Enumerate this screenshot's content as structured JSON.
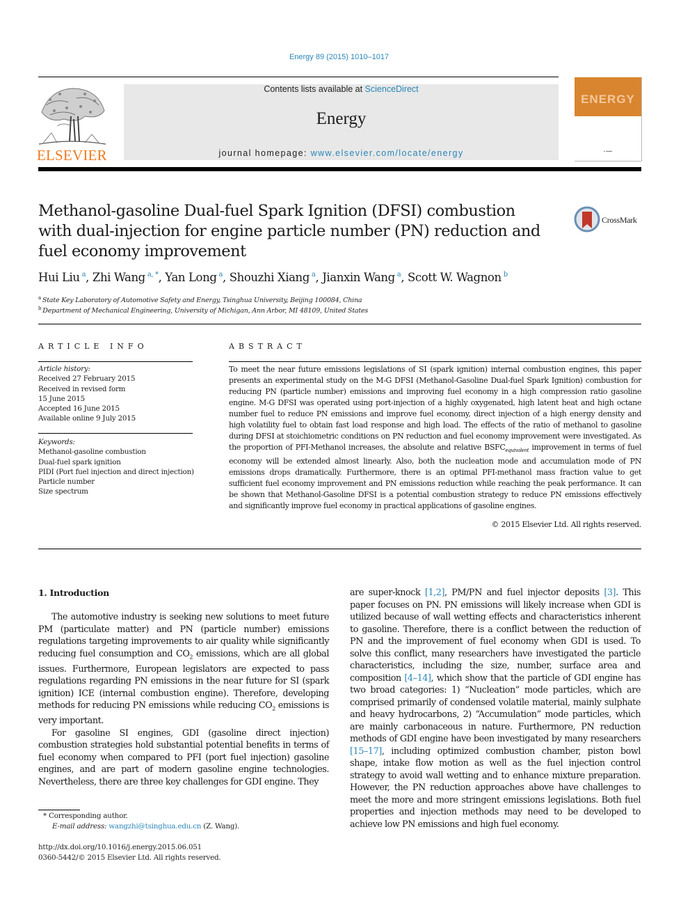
{
  "header": {
    "citation": "Energy 89 (2015) 1010–1017",
    "contents_prefix": "Contents lists available at ",
    "contents_link": "ScienceDirect",
    "journal_name": "Energy",
    "homepage_prefix": "journal homepage: ",
    "homepage_link": "www.elsevier.com/locate/energy",
    "publisher_logo_text": "ELSEVIER",
    "cover_word": "ENERGY",
    "brand_color": "#f07a1e",
    "link_color": "#2a86b8",
    "cover_color": "#d9852f"
  },
  "article": {
    "title": "Methanol-gasoline Dual-fuel Spark Ignition (DFSI) combustion with dual-injection for engine particle number (PN) reduction and fuel economy improvement",
    "crossmark_label": "CrossMark",
    "authors": [
      {
        "name": "Hui Liu",
        "affil": "a"
      },
      {
        "name": "Zhi Wang",
        "affil": "a, *"
      },
      {
        "name": "Yan Long",
        "affil": "a"
      },
      {
        "name": "Shouzhi Xiang",
        "affil": "a"
      },
      {
        "name": "Jianxin Wang",
        "affil": "a"
      },
      {
        "name": "Scott W. Wagnon",
        "affil": "b"
      }
    ],
    "affiliations": [
      {
        "mark": "a",
        "text": "State Key Laboratory of Automotive Safety and Energy, Tsinghua University, Beijing 100084, China"
      },
      {
        "mark": "b",
        "text": "Department of Mechanical Engineering, University of Michigan, Ann Arbor, MI 48109, United States"
      }
    ]
  },
  "article_info": {
    "heading": "ARTICLE INFO",
    "history_label": "Article history:",
    "history": [
      "Received 27 February 2015",
      "Received in revised form",
      "15 June 2015",
      "Accepted 16 June 2015",
      "Available online 9 July 2015"
    ],
    "keywords_label": "Keywords:",
    "keywords": [
      "Methanol-gasoline combustion",
      "Dual-fuel spark ignition",
      "PIDI (Port fuel injection and direct injection)",
      "Particle number",
      "Size spectrum"
    ]
  },
  "abstract": {
    "heading": "ABSTRACT",
    "text_before_sub": "To meet the near future emissions legislations of SI (spark ignition) internal combustion engines, this paper presents an experimental study on the M-G DFSI (Methanol-Gasoline Dual-fuel Spark Ignition) combustion for reducing PN (particle number) emissions and improving fuel economy in a high compression ratio gasoline engine. M-G DFSI was operated using port-injection of a highly oxygenated, high latent heat and high octane number fuel to reduce PN emissions and improve fuel economy, direct injection of a high energy density and high volatility fuel to obtain fast load response and high load. The effects of the ratio of methanol to gasoline during DFSI at stoichiometric conditions on PN reduction and fuel economy improvement were investigated. As the proportion of PFI-Methanol increases, the absolute and relative BSFC",
    "subscript": "equivalent",
    "text_after_sub": " improvement in terms of fuel economy will be extended almost linearly. Also, both the nucleation mode and accumulation mode of PN emissions drops dramatically. Furthermore, there is an optimal PFI-methanol mass fraction value to get sufficient fuel economy improvement and PN emissions reduction while reaching the peak performance. It can be shown that Methanol-Gasoline DFSI is a potential combustion strategy to reduce PN emissions effectively and significantly improve fuel economy in practical applications of gasoline engines.",
    "copyright": "© 2015 Elsevier Ltd. All rights reserved."
  },
  "introduction": {
    "heading": "1.  Introduction",
    "p1_a": "The automotive industry is seeking new solutions to meet future PM (particulate matter) and PN (particle number) emissions regulations targeting improvements to air quality while significantly reducing fuel consumption and CO",
    "p1_b": " emissions, which are all global issues. Furthermore, European legislators are expected to pass regulations regarding PN emissions in the near future for SI (spark ignition) ICE (internal combustion engine). Therefore, developing methods for reducing PN emissions while reducing CO",
    "p1_c": " emissions is very important.",
    "sub2": "2",
    "p2": "For gasoline SI engines, GDI (gasoline direct injection) combustion strategies hold substantial potential benefits in terms of fuel economy when compared to PFI (port fuel injection) gasoline engines, and are part of modern gasoline engine technologies. Nevertheless, there are three key challenges for GDI engine. They",
    "r1": "are super-knock ",
    "ref1": "[1,2]",
    "r2": ", PM/PN and fuel injector deposits ",
    "ref2": "[3]",
    "r3": ". This paper focuses on PN. PN emissions will likely increase when GDI is utilized because of wall wetting effects and characteristics inherent to gasoline. Therefore, there is a conflict between the reduction of PN and the improvement of fuel economy when GDI is used. To solve this conflict, many researchers have investigated the particle characteristics, including the size, number, surface area and composition ",
    "ref3": "[4–14]",
    "r4": ", which show that the particle of GDI engine has two broad categories: 1) “Nucleation” mode particles, which are comprised primarily of condensed volatile material, mainly sulphate and heavy hydrocarbons, 2) “Accumulation” mode particles, which are mainly carbonaceous in nature. Furthermore, PN reduction methods of GDI engine have been investigated by many researchers ",
    "ref4": "[15–17]",
    "r5": ", including optimized combustion chamber, piston bowl shape, intake flow motion as well as the fuel injection control strategy to avoid wall wetting and to enhance mixture preparation. However, the PN reduction approaches above have challenges to meet the more and more stringent emissions legislations. Both fuel properties and injection methods may need to be developed to achieve low PN emissions and high fuel economy."
  },
  "footnotes": {
    "corresponding": "* Corresponding author.",
    "email_label": "E-mail address: ",
    "email": "wangzhi@tsinghua.edu.cn",
    "email_suffix": " (Z. Wang).",
    "doi": "http://dx.doi.org/10.1016/j.energy.2015.06.051",
    "issn_copyright": "0360-5442/© 2015 Elsevier Ltd. All rights reserved."
  }
}
